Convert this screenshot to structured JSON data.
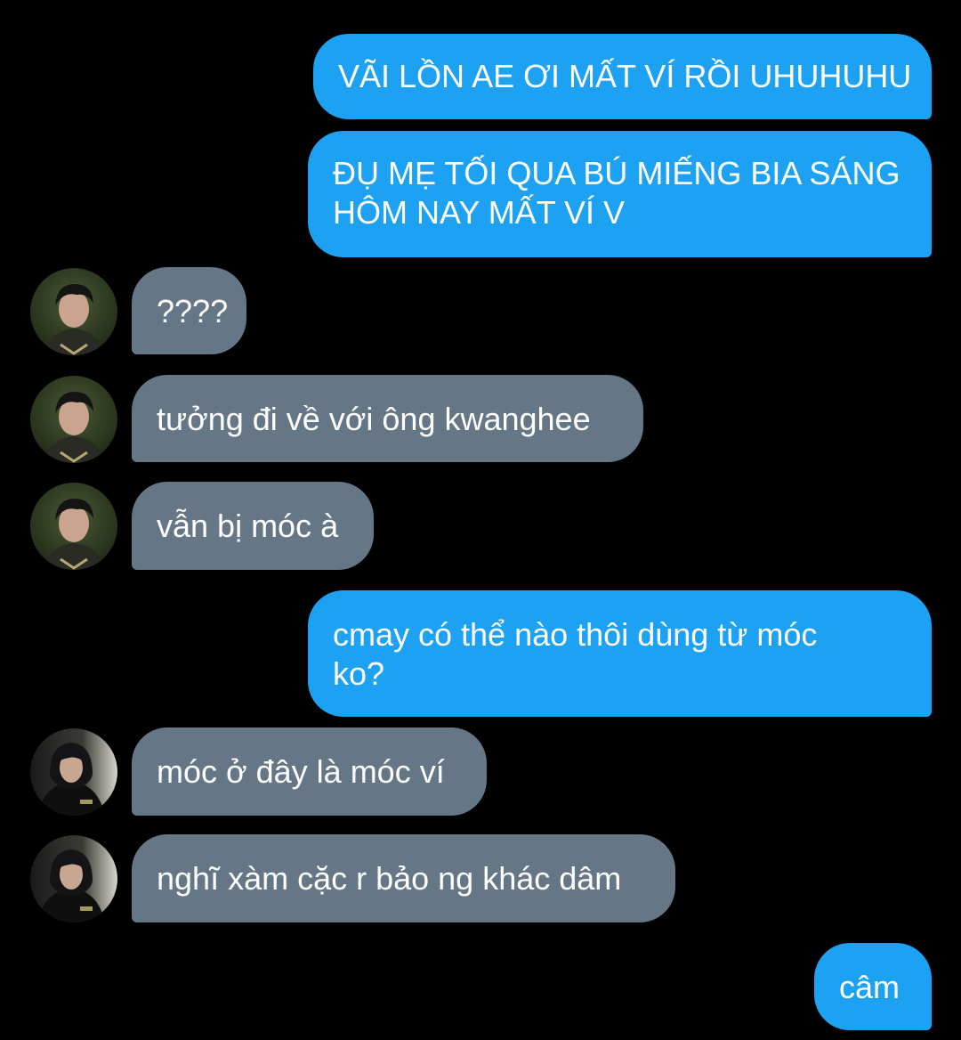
{
  "conversation": {
    "messages": [
      {
        "sender": "me",
        "text": "VÃI LỒN AE ƠI MẤT VÍ RỒI UHUHUHU"
      },
      {
        "sender": "me",
        "lines": [
          "ĐỤ MẸ TỐI QUA BÚ MIẾNG BIA SÁNG",
          "HÔM NAY MẤT VÍ V"
        ]
      },
      {
        "sender": "friend-1",
        "text": "????"
      },
      {
        "sender": "friend-1",
        "text": "tưởng đi về với ông kwanghee"
      },
      {
        "sender": "friend-1",
        "text": "vẫn bị móc à"
      },
      {
        "sender": "me",
        "lines": [
          "cmay có thể nào thôi dùng từ móc",
          "ko?"
        ]
      },
      {
        "sender": "friend-2",
        "text": "móc ở đây là móc ví"
      },
      {
        "sender": "friend-2",
        "text": "nghĩ xàm cặc r bảo ng khác dâm"
      },
      {
        "sender": "me",
        "text": "câm"
      }
    ]
  },
  "colors": {
    "background": "#000000",
    "outgoing_bubble": "#1da1f2",
    "incoming_bubble": "#657786",
    "text": "#ffffff"
  },
  "icons": {
    "friend_1_avatar": "profile-photo",
    "friend_2_avatar": "profile-photo"
  }
}
